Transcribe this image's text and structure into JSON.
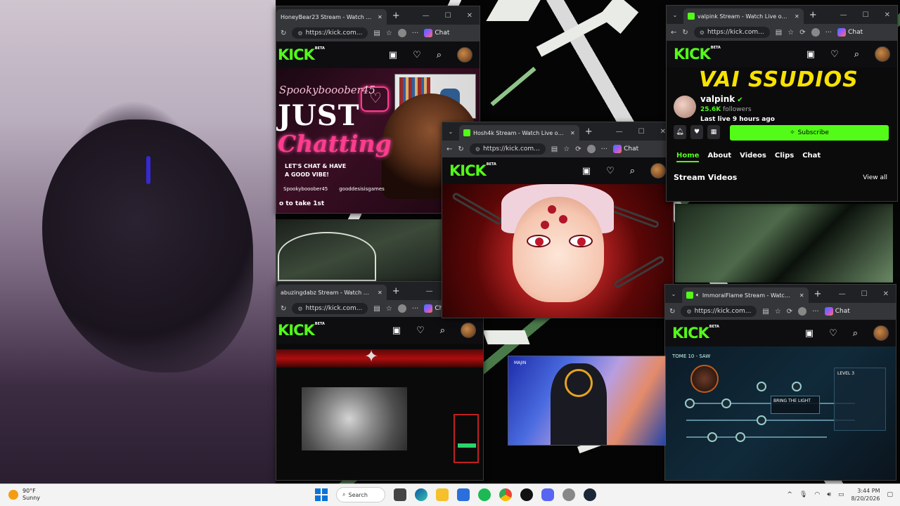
{
  "taskbar": {
    "weather_temp": "90°F",
    "weather_desc": "Sunny",
    "search_label": "Search",
    "time": "3:44 PM",
    "date": "8/20/2026"
  },
  "browser": {
    "url": "https://kick.com...",
    "chat_label": "Chat",
    "kick_logo": "KICK",
    "beta_badge": "BETA"
  },
  "windows": {
    "honeybear": {
      "tab_title": "HoneyBear23 Stream - Watch Live on Kick",
      "overlay_name": "Spookybooober45",
      "overlay_just": "JUST",
      "overlay_chatting": "Chatting",
      "overlay_vibe_1": "LET'S CHAT & HAVE",
      "overlay_vibe_2": "A GOOD VIBE!",
      "social_1": "Spookybooober45",
      "social_2": "gooddesisisgames",
      "stream_title": "o to take 1st"
    },
    "hoshi": {
      "tab_title": "Hosh4k Stream - Watch Live on Kick"
    },
    "abuzing": {
      "tab_title": "abuzingdabz Stream - Watch Live on Kick"
    },
    "valpink": {
      "tab_title": "valpink Stream - Watch Live on Kick",
      "banner": "VAI SSUDIOS",
      "username": "valpink",
      "followers_count": "25.6K",
      "followers_label": "followers",
      "last_live": "Last live 9 hours ago",
      "subscribe": "Subscribe",
      "nav": [
        "Home",
        "About",
        "Videos",
        "Clips",
        "Chat"
      ],
      "stream_videos": "Stream Videos",
      "view_all": "View all"
    },
    "immoral": {
      "tab_title": "ImmoralFlame Stream - Watch Live on Kick",
      "tome": "TOME 10 - SAW",
      "bring_light": "BRING THE LIGHT",
      "level": "LEVEL 3"
    }
  },
  "floating_video": {
    "label": "MAJIN"
  },
  "colors": {
    "kick_green": "#53fc18",
    "taskbar_bg": "#f3f3f3",
    "browser_bg": "#202124"
  }
}
